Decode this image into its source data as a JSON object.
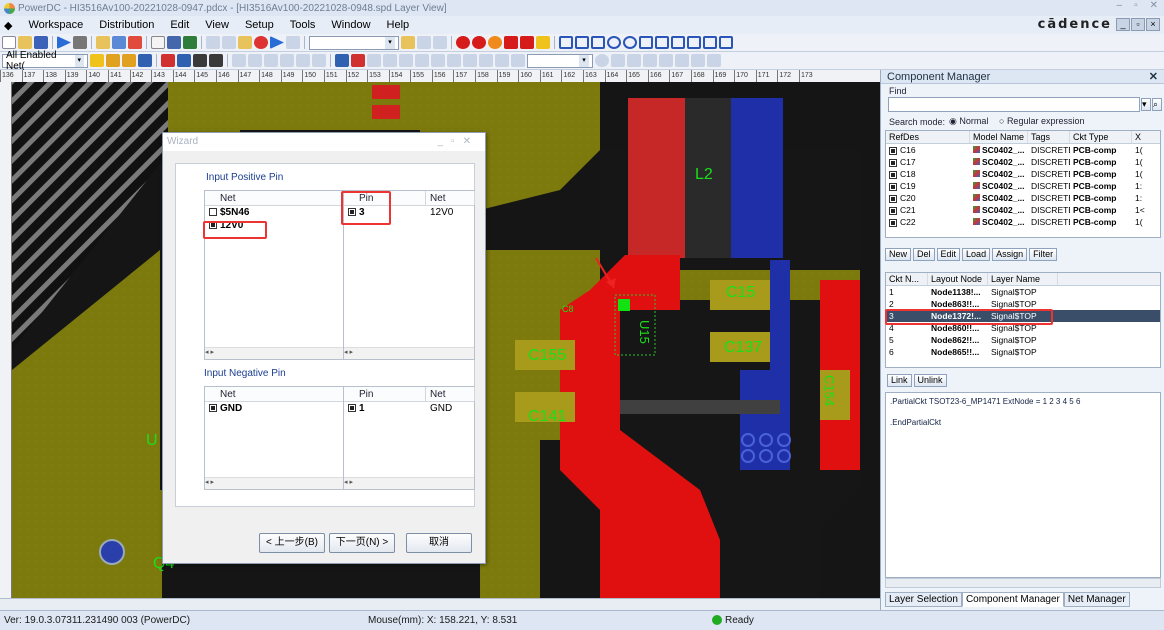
{
  "window": {
    "title": "PowerDC - HI3516Av100-20221028-0947.pdcx - [HI3516Av100-20221028-0948.spd Layer View]"
  },
  "menu": [
    "Workspace",
    "Distribution",
    "Edit",
    "View",
    "Setup",
    "Tools",
    "Window",
    "Help"
  ],
  "brand": "cādence",
  "toolbar": {
    "net_filter": "All Enabled Net("
  },
  "ruler": {
    "ticks": [
      "136",
      "137",
      "138",
      "139",
      "140",
      "141",
      "142",
      "143",
      "144",
      "145",
      "146",
      "147",
      "148",
      "149",
      "150",
      "151",
      "152",
      "153",
      "154",
      "155",
      "156",
      "157",
      "158",
      "159",
      "160",
      "161",
      "162",
      "163",
      "164",
      "165",
      "166",
      "167",
      "168",
      "169",
      "170",
      "171",
      "172",
      "173"
    ]
  },
  "board_labels": {
    "l2": "L2",
    "c15": "C15",
    "c155": "C155",
    "c137": "C137",
    "c141": "C141",
    "c154": "C154",
    "u15": "U15",
    "q4": "Q4",
    "u": "U",
    "c8": "C8"
  },
  "wizard": {
    "title": "Wizard",
    "positive": {
      "heading": "Input Positive Pin",
      "net_header": "Net",
      "pin_header": "Pin",
      "net2_header": "Net",
      "nets": [
        {
          "name": "$5N46",
          "checked": false
        },
        {
          "name": "12V0",
          "checked": true
        }
      ],
      "pins": [
        {
          "pin": "3",
          "net": "12V0",
          "checked": true
        }
      ]
    },
    "negative": {
      "heading": "Input Negative Pin",
      "net_header": "Net",
      "pin_header": "Pin",
      "net2_header": "Net",
      "nets": [
        {
          "name": "GND",
          "checked": true
        }
      ],
      "pins": [
        {
          "pin": "1",
          "net": "GND",
          "checked": true
        }
      ]
    },
    "buttons": {
      "back": "< 上一步(B)",
      "next": "下一页(N) >",
      "cancel": "取消"
    }
  },
  "component_manager": {
    "title": "Component Manager",
    "find_label": "Find",
    "search_mode_label": "Search mode:",
    "mode_normal": "Normal",
    "mode_regex": "Regular expression",
    "columns": [
      "RefDes",
      "Model Name",
      "Tags",
      "Ckt Type",
      "X"
    ],
    "rows": [
      {
        "refdes": "C16",
        "model": "SC0402_...",
        "tag": "DISCRETE",
        "type": "PCB-comp",
        "x": "1("
      },
      {
        "refdes": "C17",
        "model": "SC0402_...",
        "tag": "DISCRETE",
        "type": "PCB-comp",
        "x": "1("
      },
      {
        "refdes": "C18",
        "model": "SC0402_...",
        "tag": "DISCRETE",
        "type": "PCB-comp",
        "x": "1("
      },
      {
        "refdes": "C19",
        "model": "SC0402_...",
        "tag": "DISCRETE",
        "type": "PCB-comp",
        "x": "1:"
      },
      {
        "refdes": "C20",
        "model": "SC0402_...",
        "tag": "DISCRETE",
        "type": "PCB-comp",
        "x": "1:"
      },
      {
        "refdes": "C21",
        "model": "SC0402_...",
        "tag": "DISCRETE",
        "type": "PCB-comp",
        "x": "1<"
      },
      {
        "refdes": "C22",
        "model": "SC0402_...",
        "tag": "DISCRETE",
        "type": "PCB-comp",
        "x": "1("
      }
    ],
    "buttons": [
      "New",
      "Del",
      "Edit",
      "Load",
      "Assign",
      "Filter"
    ],
    "node_columns": [
      "Ckt N...",
      "Layout Node",
      "Layer Name"
    ],
    "nodes": [
      {
        "n": "1",
        "node": "Node1138!...",
        "layer": "Signal$TOP"
      },
      {
        "n": "2",
        "node": "Node863!!...",
        "layer": "Signal$TOP"
      },
      {
        "n": "3",
        "node": "Node1372!...",
        "layer": "Signal$TOP"
      },
      {
        "n": "4",
        "node": "Node860!!...",
        "layer": "Signal$TOP"
      },
      {
        "n": "5",
        "node": "Node862!!...",
        "layer": "Signal$TOP"
      },
      {
        "n": "6",
        "node": "Node865!!...",
        "layer": "Signal$TOP"
      }
    ],
    "link": "Link",
    "unlink": "Unlink",
    "spice": [
      ".PartialCkt TSOT23-6_MP1471 ExtNode = 1 2 3 4 5 6",
      ".EndPartialCkt"
    ]
  },
  "panel_tabs": [
    "Layer Selection",
    "Component Manager",
    "Net Manager"
  ],
  "status": {
    "version": "Ver: 19.0.3.07311.231490  003 (PowerDC)",
    "mouse": "Mouse(mm): X: 158.221, Y: 8.531",
    "ready": "Ready"
  }
}
